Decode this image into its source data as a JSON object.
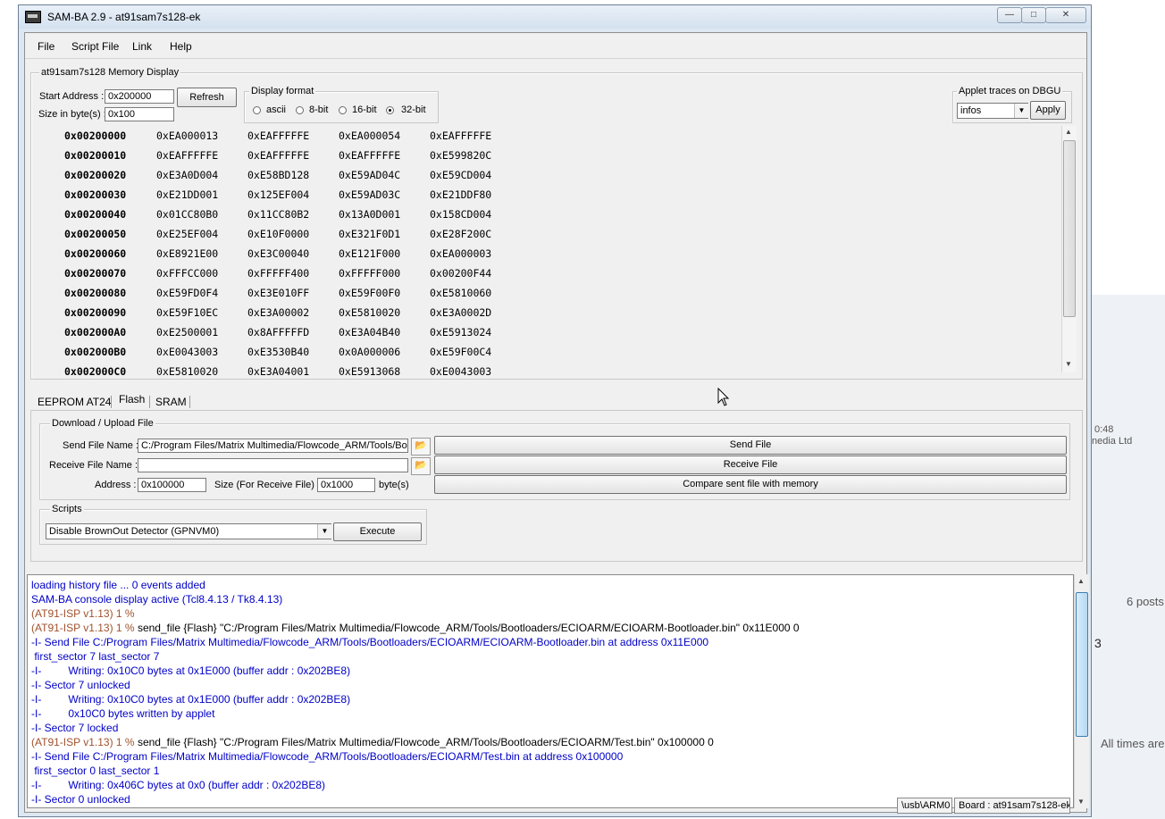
{
  "background": {
    "texts": [
      "0:48",
      "nedia Ltd",
      "6 posts",
      "3",
      "All times are"
    ]
  },
  "window": {
    "title": "SAM-BA 2.9  - at91sam7s128-ek",
    "controls": {
      "minimize": "—",
      "maximize": "□",
      "close": "✕"
    }
  },
  "menu": [
    "File",
    "Script File",
    "Link",
    "Help"
  ],
  "memory_display": {
    "group_label": "at91sam7s128 Memory Display",
    "start_address_label": "Start Address :",
    "start_address": "0x200000",
    "size_label": "Size in byte(s) :",
    "size": "0x100",
    "refresh_label": "Refresh",
    "format_group_label": "Display format",
    "formats": [
      "ascii",
      "8-bit",
      "16-bit",
      "32-bit"
    ],
    "selected_format": "32-bit",
    "applet_group_label": "Applet traces on DBGU",
    "applet_level": "infos",
    "apply_label": "Apply",
    "rows": [
      [
        "0x00200000",
        "0xEA000013",
        "0xEAFFFFFE",
        "0xEA000054",
        "0xEAFFFFFE"
      ],
      [
        "0x00200010",
        "0xEAFFFFFE",
        "0xEAFFFFFE",
        "0xEAFFFFFE",
        "0xE599820C"
      ],
      [
        "0x00200020",
        "0xE3A0D004",
        "0xE58BD128",
        "0xE59AD04C",
        "0xE59CD004"
      ],
      [
        "0x00200030",
        "0xE21DD001",
        "0x125EF004",
        "0xE59AD03C",
        "0xE21DDF80"
      ],
      [
        "0x00200040",
        "0x01CC80B0",
        "0x11CC80B2",
        "0x13A0D001",
        "0x158CD004"
      ],
      [
        "0x00200050",
        "0xE25EF004",
        "0xE10F0000",
        "0xE321F0D1",
        "0xE28F200C"
      ],
      [
        "0x00200060",
        "0xE8921E00",
        "0xE3C00040",
        "0xE121F000",
        "0xEA000003"
      ],
      [
        "0x00200070",
        "0xFFFCC000",
        "0xFFFFF400",
        "0xFFFFF000",
        "0x00200F44"
      ],
      [
        "0x00200080",
        "0xE59FD0F4",
        "0xE3E010FF",
        "0xE59F00F0",
        "0xE5810060"
      ],
      [
        "0x00200090",
        "0xE59F10EC",
        "0xE3A00002",
        "0xE5810020",
        "0xE3A0002D"
      ],
      [
        "0x002000A0",
        "0xE2500001",
        "0x8AFFFFFD",
        "0xE3A04B40",
        "0xE5913024"
      ],
      [
        "0x002000B0",
        "0xE0043003",
        "0xE3530B40",
        "0x0A000006",
        "0xE59F00C4"
      ],
      [
        "0x002000C0",
        "0xE5810020",
        "0xE3A04001",
        "0xE5913068",
        "0xE0043003"
      ]
    ]
  },
  "tabs": [
    "EEPROM AT24",
    "Flash",
    "SRAM"
  ],
  "active_tab": "Flash",
  "download_upload": {
    "group_label": "Download / Upload File",
    "send_label": "Send File Name :",
    "send_value": "C:/Program Files/Matrix Multimedia/Flowcode_ARM/Tools/Boo",
    "receive_label": "Receive File Name :",
    "receive_value": "",
    "address_label": "Address :",
    "address_value": "0x100000",
    "size_label": "Size (For Receive File) :",
    "size_value": "0x1000",
    "size_unit": "byte(s)",
    "send_button": "Send File",
    "receive_button": "Receive File",
    "compare_button": "Compare sent file with memory"
  },
  "scripts": {
    "group_label": "Scripts",
    "selected": "Disable BrownOut Detector (GPNVM0)",
    "execute_label": "Execute"
  },
  "console": [
    {
      "text": "loading history file ... 0 events added",
      "style": "blue"
    },
    {
      "text": "SAM-BA console display active (Tcl8.4.13 / Tk8.4.13)",
      "style": "blue"
    },
    {
      "text": "(AT91-ISP v1.13) 1 %",
      "style": "brown"
    },
    {
      "prompt": "(AT91-ISP v1.13) 1 % ",
      "text": "send_file {Flash} \"C:/Program Files/Matrix Multimedia/Flowcode_ARM/Tools/Bootloaders/ECIOARM/ECIOARM-Bootloader.bin\" 0x11E000 0",
      "style": "mixed"
    },
    {
      "text": "-I- Send File C:/Program Files/Matrix Multimedia/Flowcode_ARM/Tools/Bootloaders/ECIOARM/ECIOARM-Bootloader.bin at address 0x11E000",
      "style": "blue"
    },
    {
      "text": " first_sector 7 last_sector 7",
      "style": "blue"
    },
    {
      "text": "-I-         Writing: 0x10C0 bytes at 0x1E000 (buffer addr : 0x202BE8)",
      "style": "blue"
    },
    {
      "text": "-I- Sector 7 unlocked",
      "style": "blue"
    },
    {
      "text": "-I-         Writing: 0x10C0 bytes at 0x1E000 (buffer addr : 0x202BE8)",
      "style": "blue"
    },
    {
      "text": "-I-         0x10C0 bytes written by applet",
      "style": "blue"
    },
    {
      "text": "-I- Sector 7 locked",
      "style": "blue"
    },
    {
      "prompt": "(AT91-ISP v1.13) 1 % ",
      "text": "send_file {Flash} \"C:/Program Files/Matrix Multimedia/Flowcode_ARM/Tools/Bootloaders/ECIOARM/Test.bin\" 0x100000 0",
      "style": "mixed"
    },
    {
      "text": "-I- Send File C:/Program Files/Matrix Multimedia/Flowcode_ARM/Tools/Bootloaders/ECIOARM/Test.bin at address 0x100000",
      "style": "blue"
    },
    {
      "text": " first_sector 0 last_sector 1",
      "style": "blue"
    },
    {
      "text": "-I-         Writing: 0x406C bytes at 0x0 (buffer addr : 0x202BE8)",
      "style": "blue"
    },
    {
      "text": "-I- Sector 0 unlocked",
      "style": "blue"
    }
  ],
  "status": {
    "connection": "\\usb\\ARM0",
    "board": "Board : at91sam7s128-ek"
  }
}
